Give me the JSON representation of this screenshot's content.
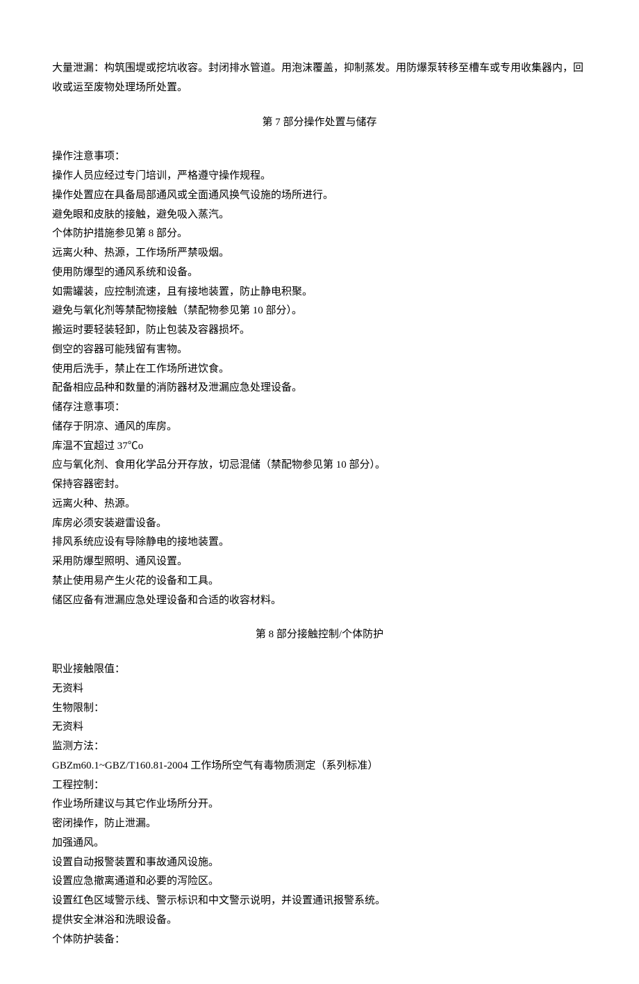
{
  "intro_para": "大量泄漏：构筑围堤或挖坑收容。封闭排水管道。用泡沫覆盖，抑制蒸发。用防爆泵转移至槽车或专用收集器内，回收或运至废物处理场所处置。",
  "section7": {
    "heading": "第 7 部分操作处置与储存",
    "lines": [
      "操作注意事项：",
      "操作人员应经过专门培训，严格遵守操作规程。",
      "操作处置应在具备局部通风或全面通风换气设施的场所进行。",
      "避免眼和皮肤的接触，避免吸入蒸汽。",
      "个体防护措施参见第 8 部分。",
      "远离火种、热源，工作场所严禁吸烟。",
      "使用防爆型的通风系统和设备。",
      "如需罐装，应控制流速，且有接地装置，防止静电积聚。",
      "避免与氧化剂等禁配物接触（禁配物参见第 10 部分）。",
      "搬运时要轻装轻卸，防止包装及容器损坏。",
      "倒空的容器可能残留有害物。",
      "使用后洗手，禁止在工作场所进饮食。",
      "配备相应品种和数量的消防器材及泄漏应急处理设备。",
      "储存注意事项：",
      "储存于阴凉、通风的库房。",
      "库温不宜超过 37℃o",
      "应与氧化剂、食用化学品分开存放，切忌混储（禁配物参见第 10 部分）。",
      "保持容器密封。",
      "远离火种、热源。",
      "库房必须安装避雷设备。",
      "排风系统应设有导除静电的接地装置。",
      "采用防爆型照明、通风设置。",
      "禁止使用易产生火花的设备和工具。",
      "储区应备有泄漏应急处理设备和合适的收容材料。"
    ]
  },
  "section8": {
    "heading": "第 8 部分接触控制/个体防护",
    "lines": [
      "职业接触限值：",
      "无资料",
      "生物限制：",
      "无资料",
      "监测方法：",
      "GBZm60.1~GBZ/T160.81-2004 工作场所空气有毒物质测定（系列标准）",
      "工程控制：",
      "作业场所建议与其它作业场所分开。",
      "密闭操作，防止泄漏。",
      "加强通风。",
      "设置自动报警装置和事故通风设施。",
      "设置应急撤离通道和必要的泻险区。",
      "设置红色区域警示线、警示标识和中文警示说明，并设置通讯报警系统。",
      "提供安全淋浴和洗眼设备。",
      "个体防护装备："
    ]
  }
}
